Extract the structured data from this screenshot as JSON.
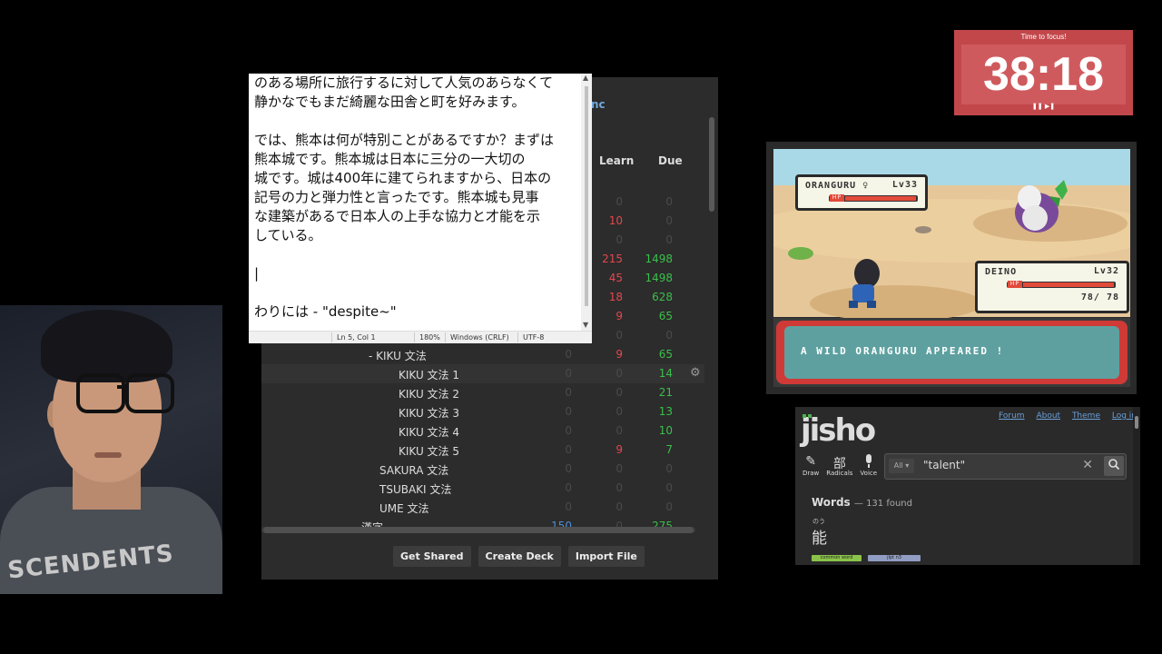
{
  "notepad": {
    "text": "のある場所に旅行するに対して人気のあらなくて\n静かなでもまだ綺麗な田舎と町を好みます。\n\nでは、熊本は何が特別ことがあるですか？まずは\n熊本城です。熊本城は日本に三分の一大切の\n城です。城は400年に建てられますから、日本の\n記号の力と弾力性と言ったです。熊本城も見事\nな建築があるで日本人の上手な協力と才能を示\nしている。\n\n|\n\nわりには - \"despite~\"",
    "status": {
      "position": "Ln 5, Col 1",
      "zoom": "180%",
      "line_ending": "Windows (CRLF)",
      "encoding": "UTF-8"
    }
  },
  "anki": {
    "sync_label": "nc",
    "headers": {
      "learn": "Learn",
      "due": "Due"
    },
    "rows": [
      {
        "name": "",
        "new": "",
        "learn": "0",
        "due": "0",
        "learn_color": "gray",
        "due_color": "gray"
      },
      {
        "name": "",
        "new": "",
        "learn": "10",
        "due": "0",
        "learn_color": "red",
        "due_color": "gray"
      },
      {
        "name": "",
        "new": "",
        "learn": "0",
        "due": "0",
        "learn_color": "gray",
        "due_color": "gray"
      },
      {
        "name": "",
        "new": "",
        "learn": "215",
        "due": "1498",
        "learn_color": "red",
        "due_color": "green"
      },
      {
        "name": "",
        "new": "",
        "learn": "45",
        "due": "1498",
        "learn_color": "red",
        "due_color": "green"
      },
      {
        "name": "",
        "new": "",
        "learn": "18",
        "due": "628",
        "learn_color": "red",
        "due_color": "green"
      },
      {
        "name": "",
        "new": "",
        "learn": "9",
        "due": "65",
        "learn_color": "red",
        "due_color": "green"
      },
      {
        "name": "",
        "new": "",
        "learn": "0",
        "due": "0",
        "learn_color": "gray",
        "due_color": "gray"
      },
      {
        "name": "-  KIKU 文法",
        "new": "0",
        "learn": "9",
        "due": "65",
        "learn_color": "red",
        "due_color": "green",
        "indent": 118
      },
      {
        "name": "KIKU 文法 1",
        "new": "0",
        "learn": "0",
        "due": "14",
        "learn_color": "gray",
        "due_color": "green",
        "indent": 151,
        "highlight": true
      },
      {
        "name": "KIKU 文法 2",
        "new": "0",
        "learn": "0",
        "due": "21",
        "learn_color": "gray",
        "due_color": "green",
        "indent": 151
      },
      {
        "name": "KIKU 文法 3",
        "new": "0",
        "learn": "0",
        "due": "13",
        "learn_color": "gray",
        "due_color": "green",
        "indent": 151
      },
      {
        "name": "KIKU 文法 4",
        "new": "0",
        "learn": "0",
        "due": "10",
        "learn_color": "gray",
        "due_color": "green",
        "indent": 151
      },
      {
        "name": "KIKU 文法 5",
        "new": "0",
        "learn": "9",
        "due": "7",
        "learn_color": "red",
        "due_color": "green",
        "indent": 151
      },
      {
        "name": "SAKURA 文法",
        "new": "0",
        "learn": "0",
        "due": "0",
        "learn_color": "gray",
        "due_color": "gray",
        "indent": 130
      },
      {
        "name": "TSUBAKI 文法",
        "new": "0",
        "learn": "0",
        "due": "0",
        "learn_color": "gray",
        "due_color": "gray",
        "indent": 130
      },
      {
        "name": "UME 文法",
        "new": "0",
        "learn": "0",
        "due": "0",
        "learn_color": "gray",
        "due_color": "gray",
        "indent": 130
      },
      {
        "name": "漢字",
        "new": "150",
        "learn": "0",
        "due": "275",
        "learn_color": "gray",
        "due_color": "green",
        "new_color": "blue",
        "indent": 110
      }
    ],
    "buttons": {
      "get_shared": "Get Shared",
      "create_deck": "Create Deck",
      "import_file": "Import File"
    },
    "colors": {
      "red": "#e2474f",
      "green": "#3bbf4a",
      "blue": "#4a8fd8",
      "gray": "#4a4a4a"
    }
  },
  "timer": {
    "label": "Time to focus!",
    "time": "38:18",
    "controls": "❚❚ ▶❚"
  },
  "game": {
    "enemy": {
      "name": "ORANGURU ♀",
      "level": "Lv33",
      "hp_fraction": 1.0
    },
    "player": {
      "name": "DEINO",
      "level": "Lv32",
      "hp_text": "78/ 78",
      "hp_fraction": 1.0
    },
    "message": "A WILD ORANGURU APPEARED !"
  },
  "jisho": {
    "logo": "jisho",
    "links": [
      "Forum",
      "About",
      "Theme",
      "Log in"
    ],
    "tools": [
      {
        "icon": "✎",
        "icon_name": "draw-icon",
        "label": "Draw"
      },
      {
        "icon": "部",
        "icon_name": "radicals-icon",
        "label": "Radicals"
      },
      {
        "icon": "🎤",
        "icon_name": "microphone-icon",
        "label": "Voice"
      }
    ],
    "search": {
      "scope": "All",
      "query": "\"talent\""
    },
    "results_heading": "Words",
    "results_count": "— 131 found",
    "first_result": {
      "furigana": "のう",
      "word": "能",
      "tags": [
        "common word",
        "jlpt n3"
      ]
    }
  },
  "webcam": {
    "shirt_text": "SCENDENTS"
  }
}
